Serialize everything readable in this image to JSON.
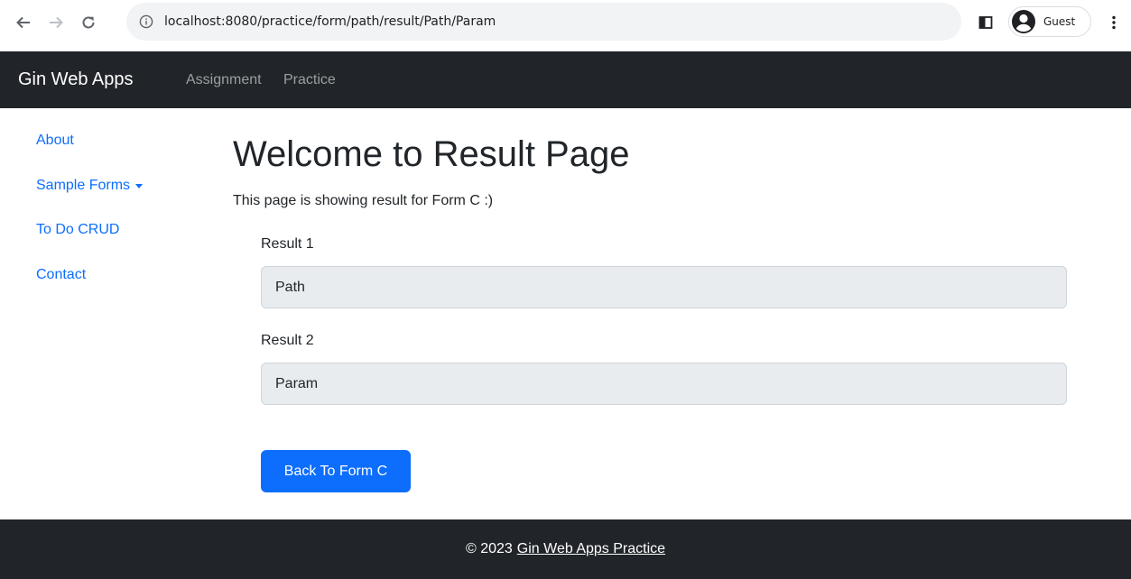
{
  "browser": {
    "url": "localhost:8080/practice/form/path/result/Path/Param",
    "profile_label": "Guest"
  },
  "navbar": {
    "brand": "Gin Web Apps",
    "links": [
      "Assignment",
      "Practice"
    ]
  },
  "sidebar": {
    "items": [
      {
        "label": "About"
      },
      {
        "label": "Sample Forms",
        "dropdown": true
      },
      {
        "label": "To Do CRUD"
      },
      {
        "label": "Contact"
      }
    ]
  },
  "main": {
    "title": "Welcome to Result Page",
    "subtitle": "This page is showing result for Form C :)",
    "result1_label": "Result 1",
    "result1_value": "Path",
    "result2_label": "Result 2",
    "result2_value": "Param",
    "back_button": "Back To Form C"
  },
  "footer": {
    "copyright": "© 2023",
    "link": "Gin Web Apps Practice"
  },
  "colors": {
    "navbar_bg": "#212529",
    "link_blue": "#0d6efd",
    "readonly_field_bg": "#e9ecef"
  }
}
